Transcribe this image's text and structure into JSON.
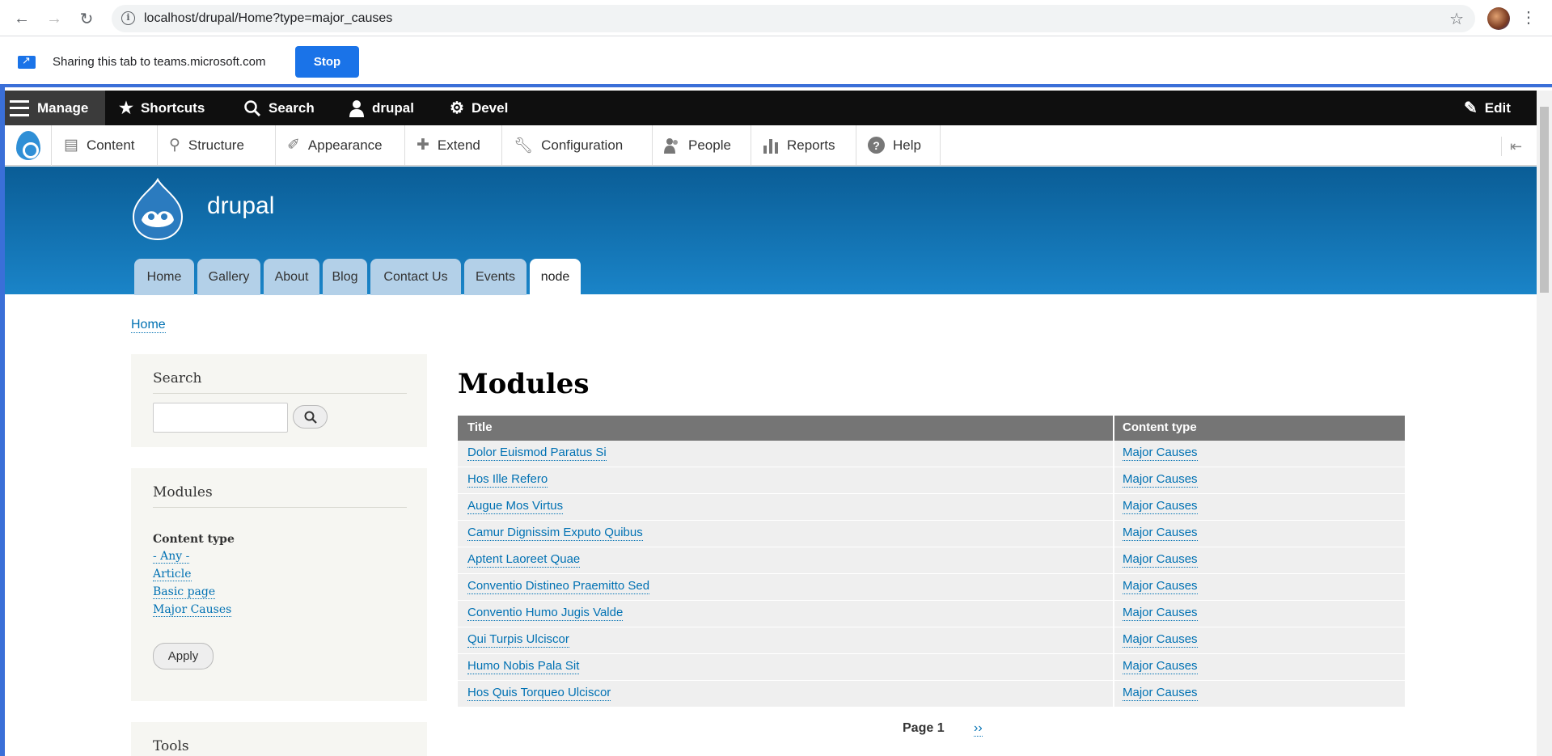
{
  "browser": {
    "url": "localhost/drupal/Home?type=major_causes",
    "back_icon": "arrow-left-icon",
    "forward_icon": "arrow-right-icon",
    "reload_icon": "reload-icon"
  },
  "share_bar": {
    "text": "Sharing this tab to teams.microsoft.com",
    "stop_label": "Stop"
  },
  "admin_toolbar": {
    "manage": "Manage",
    "shortcuts": "Shortcuts",
    "search": "Search",
    "user": "drupal",
    "devel": "Devel",
    "edit": "Edit"
  },
  "tray": {
    "items": [
      "Content",
      "Structure",
      "Appearance",
      "Extend",
      "Configuration",
      "People",
      "Reports",
      "Help"
    ]
  },
  "site": {
    "name": "drupal",
    "tabs": [
      "Home",
      "Gallery",
      "About",
      "Blog",
      "Contact Us",
      "Events",
      "node"
    ],
    "active_tab": "node"
  },
  "breadcrumb": "Home",
  "sidebar": {
    "search_title": "Search",
    "modules_title": "Modules",
    "facet_label": "Content type",
    "facets": [
      "- Any -",
      "Article",
      "Basic page",
      "Major Causes"
    ],
    "apply_label": "Apply",
    "tools_title": "Tools"
  },
  "main": {
    "title": "Modules",
    "columns": [
      "Title",
      "Content type"
    ],
    "rows": [
      [
        "Dolor Euismod Paratus Si",
        "Major Causes"
      ],
      [
        "Hos Ille Refero",
        "Major Causes"
      ],
      [
        "Augue Mos Virtus",
        "Major Causes"
      ],
      [
        "Camur Dignissim Exputo Quibus",
        "Major Causes"
      ],
      [
        "Aptent Laoreet Quae",
        "Major Causes"
      ],
      [
        "Conventio Distineo Praemitto Sed",
        "Major Causes"
      ],
      [
        "Conventio Humo Jugis Valde",
        "Major Causes"
      ],
      [
        "Qui Turpis Ulciscor",
        "Major Causes"
      ],
      [
        "Humo Nobis Pala Sit",
        "Major Causes"
      ],
      [
        "Hos Quis Torqueo Ulciscor",
        "Major Causes"
      ]
    ],
    "pager_current": "Page 1",
    "pager_next": "››"
  },
  "colors": {
    "link": "#0071b3",
    "header_top": "#0a5d96",
    "header_bottom": "#1a84c8",
    "table_header": "#757575",
    "admin_bar": "#0f0f0f"
  }
}
